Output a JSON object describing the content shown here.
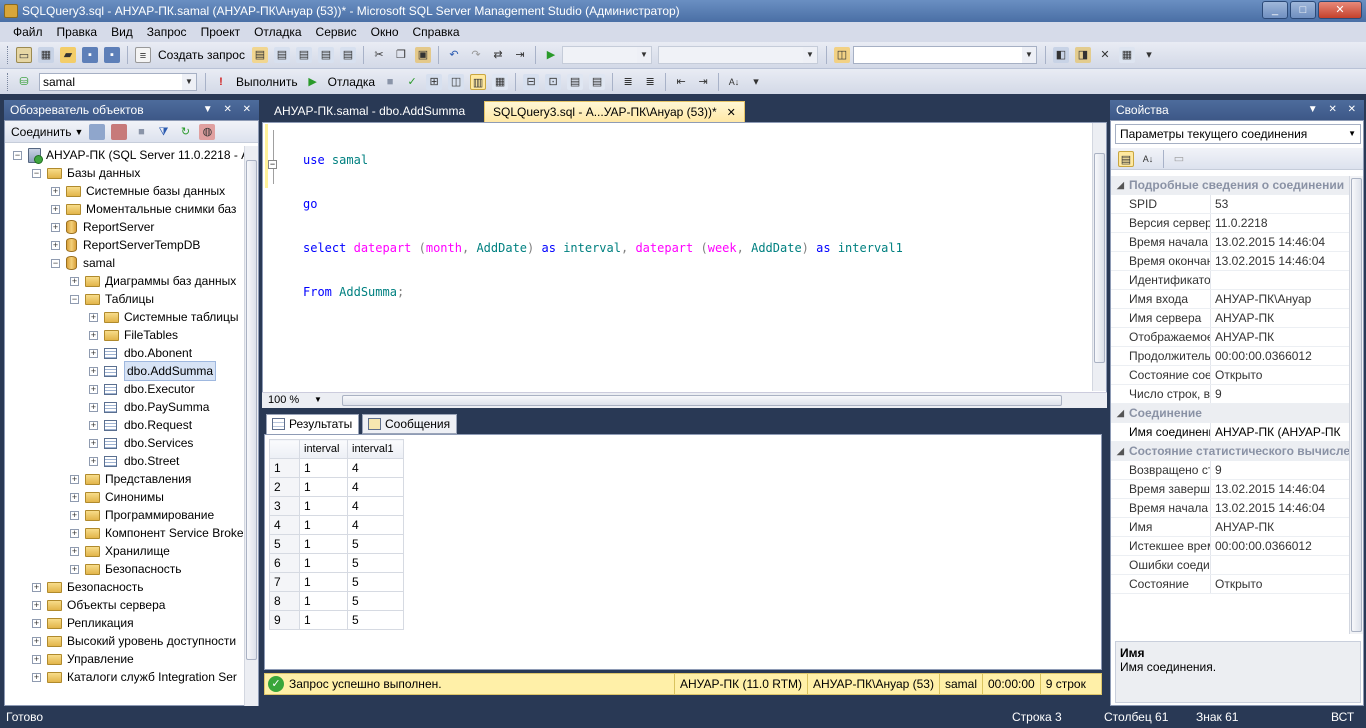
{
  "window": {
    "title": "SQLQuery3.sql - АНУАР-ПК.samal (АНУАР-ПК\\Ануар (53))* - Microsoft SQL Server Management Studio (Администратор)"
  },
  "menu": [
    "Файл",
    "Правка",
    "Вид",
    "Запрос",
    "Проект",
    "Отладка",
    "Сервис",
    "Окно",
    "Справка"
  ],
  "toolbar1": {
    "new_query": "Создать запрос"
  },
  "toolbar2": {
    "database": "samal",
    "execute": "Выполнить",
    "debug": "Отладка"
  },
  "object_explorer": {
    "title": "Обозреватель объектов",
    "connect": "Соединить",
    "nodes": [
      {
        "label": "АНУАР-ПК (SQL Server 11.0.2218 - А",
        "level": 0,
        "type": "server",
        "exp": "-"
      },
      {
        "label": "Базы данных",
        "level": 1,
        "type": "folder",
        "exp": "-"
      },
      {
        "label": "Системные базы данных",
        "level": 2,
        "type": "folder",
        "exp": "+"
      },
      {
        "label": "Моментальные снимки баз",
        "level": 2,
        "type": "folder",
        "exp": "+"
      },
      {
        "label": "ReportServer",
        "level": 2,
        "type": "db",
        "exp": "+"
      },
      {
        "label": "ReportServerTempDB",
        "level": 2,
        "type": "db",
        "exp": "+"
      },
      {
        "label": "samal",
        "level": 2,
        "type": "db",
        "exp": "-"
      },
      {
        "label": "Диаграммы баз данных",
        "level": 3,
        "type": "folder",
        "exp": "+"
      },
      {
        "label": "Таблицы",
        "level": 3,
        "type": "folder",
        "exp": "-"
      },
      {
        "label": "Системные таблицы",
        "level": 4,
        "type": "folder",
        "exp": "+"
      },
      {
        "label": "FileTables",
        "level": 4,
        "type": "folder",
        "exp": "+"
      },
      {
        "label": "dbo.Abonent",
        "level": 4,
        "type": "table",
        "exp": "+"
      },
      {
        "label": "dbo.AddSumma",
        "level": 4,
        "type": "table",
        "exp": "+",
        "selected": true
      },
      {
        "label": "dbo.Executor",
        "level": 4,
        "type": "table",
        "exp": "+"
      },
      {
        "label": "dbo.PaySumma",
        "level": 4,
        "type": "table",
        "exp": "+"
      },
      {
        "label": "dbo.Request",
        "level": 4,
        "type": "table",
        "exp": "+"
      },
      {
        "label": "dbo.Services",
        "level": 4,
        "type": "table",
        "exp": "+"
      },
      {
        "label": "dbo.Street",
        "level": 4,
        "type": "table",
        "exp": "+"
      },
      {
        "label": "Представления",
        "level": 3,
        "type": "folder",
        "exp": "+"
      },
      {
        "label": "Синонимы",
        "level": 3,
        "type": "folder",
        "exp": "+"
      },
      {
        "label": "Программирование",
        "level": 3,
        "type": "folder",
        "exp": "+"
      },
      {
        "label": "Компонент Service Broke",
        "level": 3,
        "type": "folder",
        "exp": "+"
      },
      {
        "label": "Хранилище",
        "level": 3,
        "type": "folder",
        "exp": "+"
      },
      {
        "label": "Безопасность",
        "level": 3,
        "type": "folder",
        "exp": "+"
      },
      {
        "label": "Безопасность",
        "level": 1,
        "type": "folder",
        "exp": "+"
      },
      {
        "label": "Объекты сервера",
        "level": 1,
        "type": "folder",
        "exp": "+"
      },
      {
        "label": "Репликация",
        "level": 1,
        "type": "folder",
        "exp": "+"
      },
      {
        "label": "Высокий уровень доступности",
        "level": 1,
        "type": "folder",
        "exp": "+"
      },
      {
        "label": "Управление",
        "level": 1,
        "type": "folder",
        "exp": "+"
      },
      {
        "label": "Каталоги служб Integration Ser",
        "level": 1,
        "type": "folder",
        "exp": "+"
      }
    ]
  },
  "tabs": [
    {
      "label": "АНУАР-ПК.samal - dbo.AddSumma"
    },
    {
      "label": "SQLQuery3.sql - А...УАР-ПК\\Ануар (53))*",
      "close": "✕"
    }
  ],
  "editor": {
    "line1": {
      "kw": "use",
      "id": "samal"
    },
    "line2": {
      "kw": "go"
    },
    "line3": {
      "kw_select": "select",
      "fn1": "datepart",
      "p1": "(",
      "a1": "month",
      "c1": ",",
      "col1": "AddDate",
      "p2": ")",
      "as1": "as",
      "al1": "interval",
      "c2": ",",
      "fn2": "datepart",
      "p3": "(",
      "a2": "week",
      "c3": ",",
      "col2": "AddDate",
      "p4": ")",
      "as2": "as",
      "al2": "interval1"
    },
    "line4": {
      "kw": "From",
      "id": "AddSumma",
      "semi": ";"
    },
    "zoom": "100 %"
  },
  "results": {
    "tab_results": "Результаты",
    "tab_messages": "Сообщения",
    "columns": [
      "interval",
      "interval1"
    ],
    "rows": [
      [
        "1",
        "1",
        "4"
      ],
      [
        "2",
        "1",
        "4"
      ],
      [
        "3",
        "1",
        "4"
      ],
      [
        "4",
        "1",
        "4"
      ],
      [
        "5",
        "1",
        "5"
      ],
      [
        "6",
        "1",
        "5"
      ],
      [
        "7",
        "1",
        "5"
      ],
      [
        "8",
        "1",
        "5"
      ],
      [
        "9",
        "1",
        "5"
      ]
    ]
  },
  "query_status": {
    "message": "Запрос успешно выполнен.",
    "server": "АНУАР-ПК (11.0 RTM)",
    "user": "АНУАР-ПК\\Ануар (53)",
    "db": "samal",
    "time": "00:00:00",
    "rows": "9 строк"
  },
  "properties": {
    "title": "Свойства",
    "selector": "Параметры текущего соединения",
    "rows": [
      {
        "cat": true,
        "name": "Подробные сведения о соединении"
      },
      {
        "name": "SPID",
        "value": "53"
      },
      {
        "name": "Версия сервера",
        "value": "11.0.2218"
      },
      {
        "name": "Время начала со",
        "value": "13.02.2015 14:46:04"
      },
      {
        "name": "Время окончани",
        "value": "13.02.2015 14:46:04"
      },
      {
        "name": "Идентификатор т",
        "value": ""
      },
      {
        "name": "Имя входа",
        "value": "АНУАР-ПК\\Ануар"
      },
      {
        "name": "Имя сервера",
        "value": "АНУАР-ПК"
      },
      {
        "name": "Отображаемое и",
        "value": "АНУАР-ПК"
      },
      {
        "name": "Продолжительно",
        "value": "00:00:00.0366012"
      },
      {
        "name": "Состояние соеди",
        "value": "Открыто"
      },
      {
        "name": "Число строк, воз",
        "value": "9"
      },
      {
        "cat": true,
        "name": "Соединение"
      },
      {
        "name": "Имя соединения",
        "value": "АНУАР-ПК (АНУАР-ПК",
        "sel": true
      },
      {
        "cat": true,
        "name": "Состояние статистического вычисления"
      },
      {
        "name": "Возвращено стро",
        "value": "9"
      },
      {
        "name": "Время завершени",
        "value": "13.02.2015 14:46:04"
      },
      {
        "name": "Время начала",
        "value": "13.02.2015 14:46:04"
      },
      {
        "name": "Имя",
        "value": "АНУАР-ПК"
      },
      {
        "name": "Истекшее время",
        "value": "00:00:00.0366012"
      },
      {
        "name": "Ошибки соедине",
        "value": ""
      },
      {
        "name": "Состояние",
        "value": "Открыто"
      }
    ],
    "desc_title": "Имя",
    "desc_text": "Имя соединения."
  },
  "statusbar": {
    "ready": "Готово",
    "line": "Строка 3",
    "col": "Столбец 61",
    "char": "Знак 61",
    "mode": "ВСТ"
  }
}
